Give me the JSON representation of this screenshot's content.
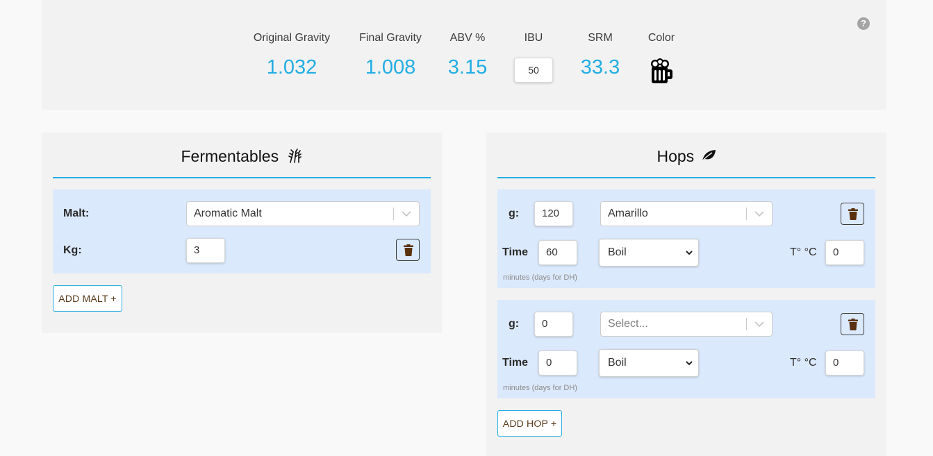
{
  "stats": {
    "og": {
      "label": "Original Gravity",
      "value": "1.032"
    },
    "fg": {
      "label": "Final Gravity",
      "value": "1.008"
    },
    "abv": {
      "label": "ABV %",
      "value": "3.15"
    },
    "ibu": {
      "label": "IBU",
      "value": "50"
    },
    "srm": {
      "label": "SRM",
      "value": "33.3"
    },
    "color": {
      "label": "Color",
      "icon": "beer-mug-icon"
    },
    "help_icon": "question-circle-icon"
  },
  "fermentables": {
    "title": "Fermentables",
    "title_icon": "wheat-icon",
    "items": [
      {
        "malt_label": "Malt:",
        "malt_value": "Aromatic Malt",
        "kg_label": "Kg:",
        "kg_value": "3"
      }
    ],
    "add_label": "ADD MALT +"
  },
  "hops": {
    "title": "Hops",
    "title_icon": "leaf-icon",
    "items": [
      {
        "g_label": "g:",
        "g_value": "120",
        "variety": "Amarillo",
        "time_label": "Time",
        "time_value": "60",
        "use": "Boil",
        "temp_label": "T° °C",
        "temp_value": "0",
        "hint": "minutes (days for DH)"
      },
      {
        "g_label": "g:",
        "g_value": "0",
        "variety_placeholder": "Select...",
        "time_label": "Time",
        "time_value": "0",
        "use": "Boil",
        "temp_label": "T° °C",
        "temp_value": "0",
        "hint": "minutes (days for DH)"
      }
    ],
    "add_label": "ADD HOP +"
  },
  "colors": {
    "accent": "#23aee3",
    "row_bg": "#dbe9fc",
    "panel_bg": "#f2f2f2",
    "trash": "#5a3210"
  }
}
